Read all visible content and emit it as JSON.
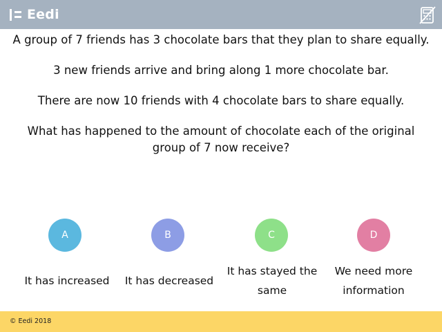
{
  "header": {
    "logo_text": "Eedi",
    "calculator_icon": "no-calculator-icon"
  },
  "question": {
    "paragraphs": [
      "A group of 7 friends has 3 chocolate bars that they plan to share equally.",
      "3 new friends arrive and bring along 1 more chocolate bar.",
      "There are now 10 friends with 4 chocolate bars to share equally.",
      "What has happened to the amount of chocolate each of the original group of 7 now receive?"
    ]
  },
  "options": [
    {
      "letter": "A",
      "text": "It has increased",
      "color": "#5bb8df"
    },
    {
      "letter": "B",
      "text": "It has decreased",
      "color": "#8d9de5"
    },
    {
      "letter": "C",
      "text": "It has stayed the same",
      "color": "#8ee089"
    },
    {
      "letter": "D",
      "text": "We need more information",
      "color": "#e27fa3"
    }
  ],
  "footer": {
    "copyright": "© Eedi 2018"
  },
  "colors": {
    "header_bg": "#a5b2c0",
    "footer_bg": "#fcd666"
  }
}
